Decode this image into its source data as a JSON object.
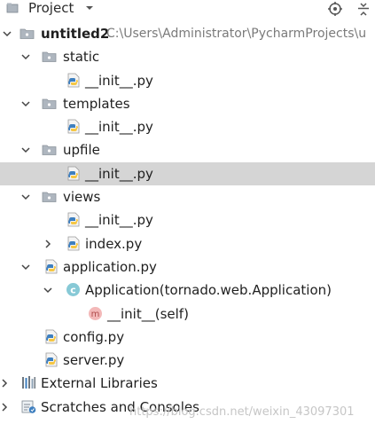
{
  "header": {
    "title": "Project"
  },
  "tree": {
    "root_label": "untitled2",
    "root_path": "C:\\Users\\Administrator\\PycharmProjects\\u",
    "static": {
      "label": "static",
      "init": "__init__.py"
    },
    "templates": {
      "label": "templates",
      "init": "__init__.py"
    },
    "upfile": {
      "label": "upfile",
      "init": "__init__.py"
    },
    "views": {
      "label": "views",
      "init": "__init__.py",
      "index": "index.py"
    },
    "application_py": "application.py",
    "application_class": "Application(tornado.web.Application)",
    "init_method": "__init__(self)",
    "config_py": "config.py",
    "server_py": "server.py",
    "external_libraries": "External Libraries",
    "scratches": "Scratches and Consoles"
  },
  "watermark": "https://blog.csdn.net/weixin_43097301",
  "colors": {
    "selection": "#d5d5d5",
    "folder": "#9aa3ad",
    "python_blue": "#3e7fbf",
    "python_yellow": "#f6c744",
    "class_circle": "#87c9d6",
    "method_circle": "#f3b8b8"
  }
}
